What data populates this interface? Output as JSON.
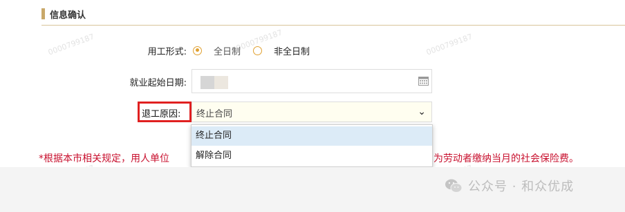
{
  "section": {
    "title": "信息确认"
  },
  "form": {
    "employment_type": {
      "label": "用工形式:",
      "options": [
        {
          "label": "全日制",
          "checked": true
        },
        {
          "label": "非全日制",
          "checked": false
        }
      ]
    },
    "start_date": {
      "label": "就业起始日期:"
    },
    "leave_reason": {
      "label": "退工原因:",
      "selected": "终止合同",
      "options": [
        "终止合同",
        "解除合同"
      ],
      "highlighted_option": "终止合同"
    }
  },
  "notice": {
    "left": "*根据本市相关规定，用人单位",
    "right": "为劳动者缴纳当月的社会保险费。"
  },
  "watermark": {
    "text": "0000799187"
  },
  "brand": {
    "text": "公众号 · 和众优成"
  },
  "colors": {
    "accent": "#c9a86a",
    "radio": "#e0a030",
    "alert_red": "#c8102e",
    "highlight_box": "#e02020",
    "option_hover": "#dcebf7"
  }
}
